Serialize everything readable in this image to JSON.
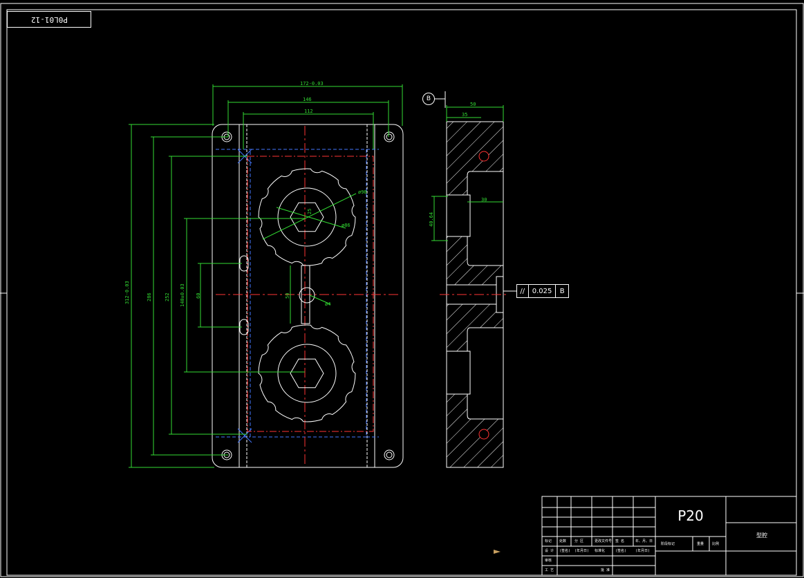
{
  "drawing": {
    "part_number": "P0L01-12",
    "title_block_code": "P20",
    "title_block_name": "型腔",
    "datum_label": "B",
    "tolerance": {
      "symbol": "//",
      "value": "0.025",
      "datum": "B"
    }
  },
  "dimensions": {
    "front_width_outer": "172-0.03",
    "front_width_mid": "146",
    "front_width_inner": "112",
    "side_width": "50",
    "side_depth": "35",
    "side_pocket": "30",
    "side_height": "40.64",
    "height_total": "312-0.03",
    "height_286": "286",
    "height_252": "252",
    "height_140": "140±0.03",
    "height_60": "60",
    "center_50": "50",
    "gear_dia": "ø98",
    "gear_inner": "ø86",
    "hex_size": "25",
    "runner": "ø4"
  },
  "title_block_cells": {
    "r1": [
      "标记",
      "处数",
      "分 区",
      "更改文件号",
      "签 名",
      "年、月、日"
    ],
    "r2": [
      "设 计",
      "(签名)",
      "(年月日)",
      "标准化",
      "(签名)",
      "(年月日)"
    ],
    "r3": [
      "审核"
    ],
    "r4": [
      "工 艺",
      "批 准"
    ],
    "stage": [
      "阶段标记",
      "重量",
      "比例"
    ]
  }
}
